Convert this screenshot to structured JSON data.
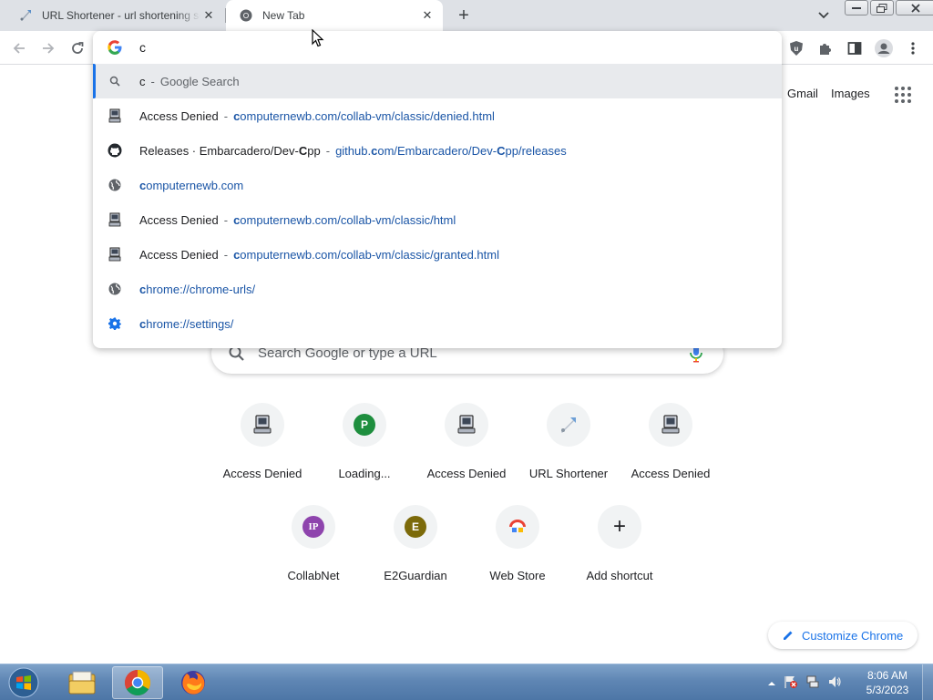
{
  "tabs": [
    {
      "title": "URL Shortener - url shortening se",
      "icon": "rocket-icon",
      "close": "✕"
    },
    {
      "title": "New Tab",
      "icon": "chrome-icon",
      "close": "✕"
    }
  ],
  "new_tab_button": "+",
  "omnibox": {
    "text": "c",
    "suggestions": [
      {
        "icon": "search-icon",
        "title": "c",
        "sep": "-",
        "url": "Google Search"
      },
      {
        "icon": "computer-icon",
        "title": "Access Denied",
        "sep": "-",
        "url_bold": "c",
        "url": "omputernewb.com/collab-vm/classic/denied.html"
      },
      {
        "icon": "github-icon",
        "title_pre": "Releases · Embarcadero/Dev-",
        "title_bold": "C",
        "title_post": "pp",
        "sep": "-",
        "url_pre": "github.",
        "url_bold": "c",
        "url_mid": "om/Embarcadero/Dev-",
        "url_bold2": "C",
        "url_post": "pp/releases"
      },
      {
        "icon": "globe-icon",
        "url_bold": "c",
        "url": "omputernewb.com"
      },
      {
        "icon": "computer-icon",
        "title": "Access Denied",
        "sep": "-",
        "url_bold": "c",
        "url": "omputernewb.com/collab-vm/classic/html"
      },
      {
        "icon": "computer-icon",
        "title": "Access Denied",
        "sep": "-",
        "url_bold": "c",
        "url": "omputernewb.com/collab-vm/classic/granted.html"
      },
      {
        "icon": "globe-icon",
        "url_bold": "c",
        "url": "hrome://chrome-urls/"
      },
      {
        "icon": "gear-icon",
        "url_bold": "c",
        "url": "hrome://settings/"
      }
    ]
  },
  "ntp": {
    "gmail": "Gmail",
    "images": "Images",
    "search_placeholder": "Search Google or type a URL",
    "shortcuts": [
      {
        "label": "Access Denied",
        "icon": "computer-icon"
      },
      {
        "label": "Loading...",
        "letter": "P",
        "color": "#1e8e3e"
      },
      {
        "label": "Access Denied",
        "icon": "computer-icon"
      },
      {
        "label": "URL Shortener",
        "icon": "rocket-icon"
      },
      {
        "label": "Access Denied",
        "icon": "computer-icon"
      },
      {
        "label": "CollabNet",
        "letter": "IP",
        "color": "#8e44ad"
      },
      {
        "label": "E2Guardian",
        "letter": "E",
        "color": "#7c6a0a"
      },
      {
        "label": "Web Store",
        "icon": "webstore-icon"
      },
      {
        "label": "Add shortcut",
        "icon": "plus-icon",
        "symbol": "+"
      }
    ],
    "customize_label": "Customize Chrome"
  },
  "taskbar": {
    "time": "8:06 AM",
    "date": "5/3/2023",
    "apps": [
      "explorer-icon",
      "chrome-icon",
      "firefox-icon"
    ]
  },
  "colors": {
    "accent": "#1a73e8",
    "url_blue": "#1a55a6",
    "tabstrip": "#dee1e6"
  }
}
